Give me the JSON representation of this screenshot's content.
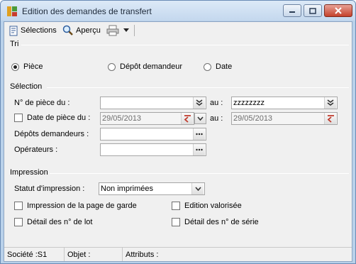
{
  "window": {
    "title": "Edition des demandes de transfert"
  },
  "toolbar": {
    "selections_label": "Sélections",
    "preview_label": "Aperçu"
  },
  "tri": {
    "group_label": "Tri",
    "options": [
      {
        "label": "Pièce",
        "selected": true
      },
      {
        "label": "Dépôt demandeur",
        "selected": false
      },
      {
        "label": "Date",
        "selected": false
      }
    ]
  },
  "selection": {
    "group_label": "Sélection",
    "piece_from_label": "N° de pièce du :",
    "piece_from_value": "",
    "piece_to_label": "au :",
    "piece_to_value": "zzzzzzzz",
    "date_label": "Date de pièce du :",
    "date_checked": false,
    "date_from_value": "29/05/2013",
    "date_to_label": "au :",
    "date_to_value": "29/05/2013",
    "depots_label": "Dépôts demandeurs :",
    "depots_value": "",
    "operateurs_label": "Opérateurs :",
    "operateurs_value": ""
  },
  "impression": {
    "group_label": "Impression",
    "statut_label": "Statut d'impression :",
    "statut_value": "Non imprimées",
    "checkboxes": [
      {
        "label": "Impression de la page de garde",
        "checked": false
      },
      {
        "label": "Edition valorisée",
        "checked": false
      },
      {
        "label": "Détail des n° de lot",
        "checked": false
      },
      {
        "label": "Détail des n° de série",
        "checked": false
      }
    ]
  },
  "statusbar": {
    "societe": "Société :S1",
    "objet": "Objet :",
    "attributs": "Attributs :"
  }
}
